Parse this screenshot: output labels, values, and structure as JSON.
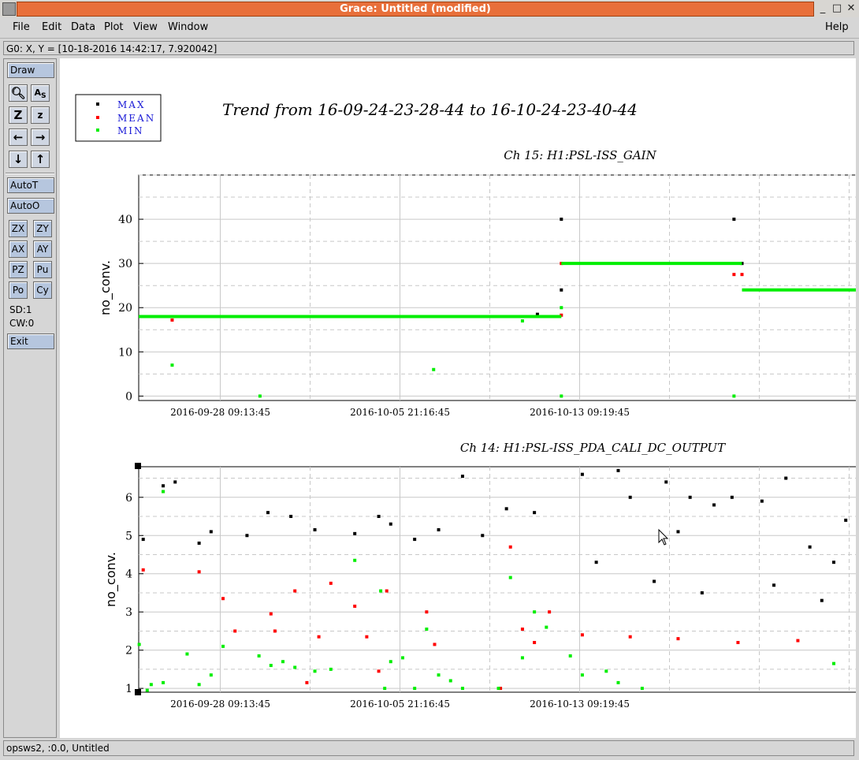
{
  "window": {
    "title": "Grace: Untitled (modified)"
  },
  "menus": [
    "File",
    "Edit",
    "Data",
    "Plot",
    "View",
    "Window"
  ],
  "help_label": "Help",
  "locator": "G0: X, Y = [10-18-2016 14:42:17, 7.920042]",
  "toolbar": {
    "draw": "Draw",
    "autot": "AutoT",
    "autoo": "AutoO",
    "zx": "ZX",
    "zy": "ZY",
    "ax": "AX",
    "ay": "AY",
    "pz": "PZ",
    "pu": "Pu",
    "po": "Po",
    "cy": "Cy",
    "sd": "SD:1",
    "cw": "CW:0",
    "exit": "Exit"
  },
  "status": "opsws2, :0.0, Untitled",
  "plot_title": "Trend from 16-09-24-23-28-44 to 16-10-24-23-40-44",
  "legend": [
    {
      "label": "MAX",
      "color": "#000000"
    },
    {
      "label": "MEAN",
      "color": "#ff0000"
    },
    {
      "label": "MIN",
      "color": "#00ee00"
    }
  ],
  "chart_data": [
    {
      "type": "scatter",
      "title": "Ch 15: H1:PSL-ISS_GAIN",
      "ylabel": "no_conv.",
      "ylim": [
        -1,
        50
      ],
      "xlim": [
        "2016-09-24 23:28:44",
        "2016-10-24 23:40:44"
      ],
      "x_ticks": [
        "2016-09-28 09:13:45",
        "2016-10-05 21:16:45",
        "2016-10-13 09:19:45"
      ],
      "y_ticks": [
        0,
        10,
        20,
        30,
        40
      ],
      "grid": true,
      "series": [
        {
          "name": "MAX",
          "color": "#000000",
          "segments": [],
          "points": [
            [
              "2016-10-11 15:00",
              18.5
            ],
            [
              "2016-10-12 15:00",
              24
            ],
            [
              "2016-10-12 15:00",
              40
            ],
            [
              "2016-10-19 20:00",
              40
            ],
            [
              "2016-10-20 04:00",
              30
            ]
          ]
        },
        {
          "name": "MEAN",
          "color": "#ff0000",
          "segments": [],
          "points": [
            [
              "2016-09-26 09:00",
              17.2
            ],
            [
              "2016-10-12 15:00",
              18.3
            ],
            [
              "2016-10-12 15:00",
              30
            ],
            [
              "2016-10-19 20:00",
              27.5
            ],
            [
              "2016-10-20 04:00",
              27.5
            ]
          ]
        },
        {
          "name": "MIN",
          "color": "#00ee00",
          "segments": [
            [
              [
                "2016-09-24 23:28",
                18
              ],
              [
                "2016-10-12 15:00",
                18
              ]
            ],
            [
              [
                "2016-10-12 15:00",
                30
              ],
              [
                "2016-10-20 04:00",
                30
              ]
            ],
            [
              [
                "2016-10-20 04:00",
                24
              ],
              [
                "2016-10-24 23:40",
                24
              ]
            ]
          ],
          "points": [
            [
              "2016-09-26 09:00",
              7
            ],
            [
              "2016-09-30 01:00",
              0
            ],
            [
              "2016-10-07 07:00",
              6
            ],
            [
              "2016-10-11 00:00",
              17
            ],
            [
              "2016-10-12 15:00",
              20
            ],
            [
              "2016-10-12 15:00",
              0
            ],
            [
              "2016-10-19 20:00",
              0
            ]
          ]
        }
      ]
    },
    {
      "type": "scatter",
      "title": "Ch 14: H1:PSL-ISS_PDA_CALI_DC_OUTPUT",
      "ylabel": "no_conv.",
      "ylim": [
        0.9,
        6.8
      ],
      "xlim": [
        "2016-09-24 23:28:44",
        "2016-10-24 23:40:44"
      ],
      "x_ticks": [
        "2016-09-28 09:13:45",
        "2016-10-05 21:16:45",
        "2016-10-13 09:19:45"
      ],
      "y_ticks": [
        1,
        2,
        3,
        4,
        5,
        6
      ],
      "grid": true,
      "series": [
        {
          "name": "MAX",
          "color": "#000000",
          "points": [
            [
              "2016-09-25 04:00",
              4.9
            ],
            [
              "2016-09-26 00:00",
              6.3
            ],
            [
              "2016-09-26 12:00",
              6.4
            ],
            [
              "2016-09-27 12:00",
              4.8
            ],
            [
              "2016-09-28 00:00",
              5.1
            ],
            [
              "2016-09-29 12:00",
              5.0
            ],
            [
              "2016-09-30 09:00",
              5.6
            ],
            [
              "2016-10-01 08:00",
              5.5
            ],
            [
              "2016-10-02 08:00",
              5.15
            ],
            [
              "2016-10-04 00:00",
              5.05
            ],
            [
              "2016-10-05 00:00",
              5.5
            ],
            [
              "2016-10-05 12:00",
              5.3
            ],
            [
              "2016-10-06 12:00",
              4.9
            ],
            [
              "2016-10-07 12:00",
              5.15
            ],
            [
              "2016-10-08 12:00",
              6.55
            ],
            [
              "2016-10-09 08:00",
              5.0
            ],
            [
              "2016-10-10 08:00",
              5.7
            ],
            [
              "2016-10-11 12:00",
              5.6
            ],
            [
              "2016-10-13 12:00",
              6.6
            ],
            [
              "2016-10-14 02:00",
              4.3
            ],
            [
              "2016-10-15 00:00",
              6.7
            ],
            [
              "2016-10-15 12:00",
              6.0
            ],
            [
              "2016-10-16 12:00",
              3.8
            ],
            [
              "2016-10-17 00:00",
              6.4
            ],
            [
              "2016-10-17 12:00",
              5.1
            ],
            [
              "2016-10-18 00:00",
              6.0
            ],
            [
              "2016-10-18 12:00",
              3.5
            ],
            [
              "2016-10-19 00:00",
              5.8
            ],
            [
              "2016-10-19 18:00",
              6.0
            ],
            [
              "2016-10-21 00:00",
              5.9
            ],
            [
              "2016-10-21 12:00",
              3.7
            ],
            [
              "2016-10-22 00:00",
              6.5
            ],
            [
              "2016-10-23 00:00",
              4.7
            ],
            [
              "2016-10-23 12:00",
              3.3
            ],
            [
              "2016-10-24 00:00",
              4.3
            ],
            [
              "2016-10-24 12:00",
              5.4
            ]
          ]
        },
        {
          "name": "MEAN",
          "color": "#ff0000",
          "points": [
            [
              "2016-09-25 04:00",
              4.1
            ],
            [
              "2016-09-26 00:00",
              6.15
            ],
            [
              "2016-09-27 12:00",
              4.05
            ],
            [
              "2016-09-28 12:00",
              3.35
            ],
            [
              "2016-09-29 00:00",
              2.5
            ],
            [
              "2016-09-30 12:00",
              2.95
            ],
            [
              "2016-09-30 16:00",
              2.5
            ],
            [
              "2016-10-01 12:00",
              3.55
            ],
            [
              "2016-10-02 00:00",
              1.15
            ],
            [
              "2016-10-02 12:00",
              2.35
            ],
            [
              "2016-10-03 00:00",
              3.75
            ],
            [
              "2016-10-04 00:00",
              3.15
            ],
            [
              "2016-10-04 12:00",
              2.35
            ],
            [
              "2016-10-05 00:00",
              1.45
            ],
            [
              "2016-10-05 08:00",
              3.55
            ],
            [
              "2016-10-07 00:00",
              3.0
            ],
            [
              "2016-10-07 08:00",
              2.15
            ],
            [
              "2016-10-10 02:00",
              1.0
            ],
            [
              "2016-10-10 12:00",
              4.7
            ],
            [
              "2016-10-11 00:00",
              2.55
            ],
            [
              "2016-10-11 12:00",
              2.2
            ],
            [
              "2016-10-12 03:00",
              3.0
            ],
            [
              "2016-10-13 12:00",
              2.4
            ],
            [
              "2016-10-15 12:00",
              2.35
            ],
            [
              "2016-10-17 12:00",
              2.3
            ],
            [
              "2016-10-20 00:00",
              2.2
            ],
            [
              "2016-10-22 12:00",
              2.25
            ]
          ]
        },
        {
          "name": "MIN",
          "color": "#00ee00",
          "points": [
            [
              "2016-09-25 00:00",
              2.15
            ],
            [
              "2016-09-25 08:00",
              0.95
            ],
            [
              "2016-09-25 12:00",
              1.1
            ],
            [
              "2016-09-26 00:00",
              6.15
            ],
            [
              "2016-09-26 00:00",
              1.15
            ],
            [
              "2016-09-27 00:00",
              1.9
            ],
            [
              "2016-09-27 12:00",
              1.1
            ],
            [
              "2016-09-28 00:00",
              1.35
            ],
            [
              "2016-09-28 12:00",
              2.1
            ],
            [
              "2016-09-30 00:00",
              1.85
            ],
            [
              "2016-09-30 12:00",
              1.6
            ],
            [
              "2016-10-01 00:00",
              1.7
            ],
            [
              "2016-10-01 12:00",
              1.55
            ],
            [
              "2016-10-02 08:00",
              1.45
            ],
            [
              "2016-10-03 00:00",
              1.5
            ],
            [
              "2016-10-04 00:00",
              4.35
            ],
            [
              "2016-10-05 02:00",
              3.55
            ],
            [
              "2016-10-05 06:00",
              1.0
            ],
            [
              "2016-10-05 12:00",
              1.7
            ],
            [
              "2016-10-06 00:00",
              1.8
            ],
            [
              "2016-10-06 12:00",
              1.0
            ],
            [
              "2016-10-07 00:00",
              2.55
            ],
            [
              "2016-10-07 12:00",
              1.35
            ],
            [
              "2016-10-08 00:00",
              1.2
            ],
            [
              "2016-10-08 12:00",
              1.0
            ],
            [
              "2016-10-10 00:00",
              1.0
            ],
            [
              "2016-10-10 12:00",
              3.9
            ],
            [
              "2016-10-11 00:00",
              1.8
            ],
            [
              "2016-10-11 12:00",
              3.0
            ],
            [
              "2016-10-12 00:00",
              2.6
            ],
            [
              "2016-10-13 00:00",
              1.85
            ],
            [
              "2016-10-13 12:00",
              1.35
            ],
            [
              "2016-10-14 12:00",
              1.45
            ],
            [
              "2016-10-15 00:00",
              1.15
            ],
            [
              "2016-10-16 00:00",
              1.0
            ],
            [
              "2016-10-24 00:00",
              1.65
            ]
          ]
        }
      ]
    }
  ]
}
